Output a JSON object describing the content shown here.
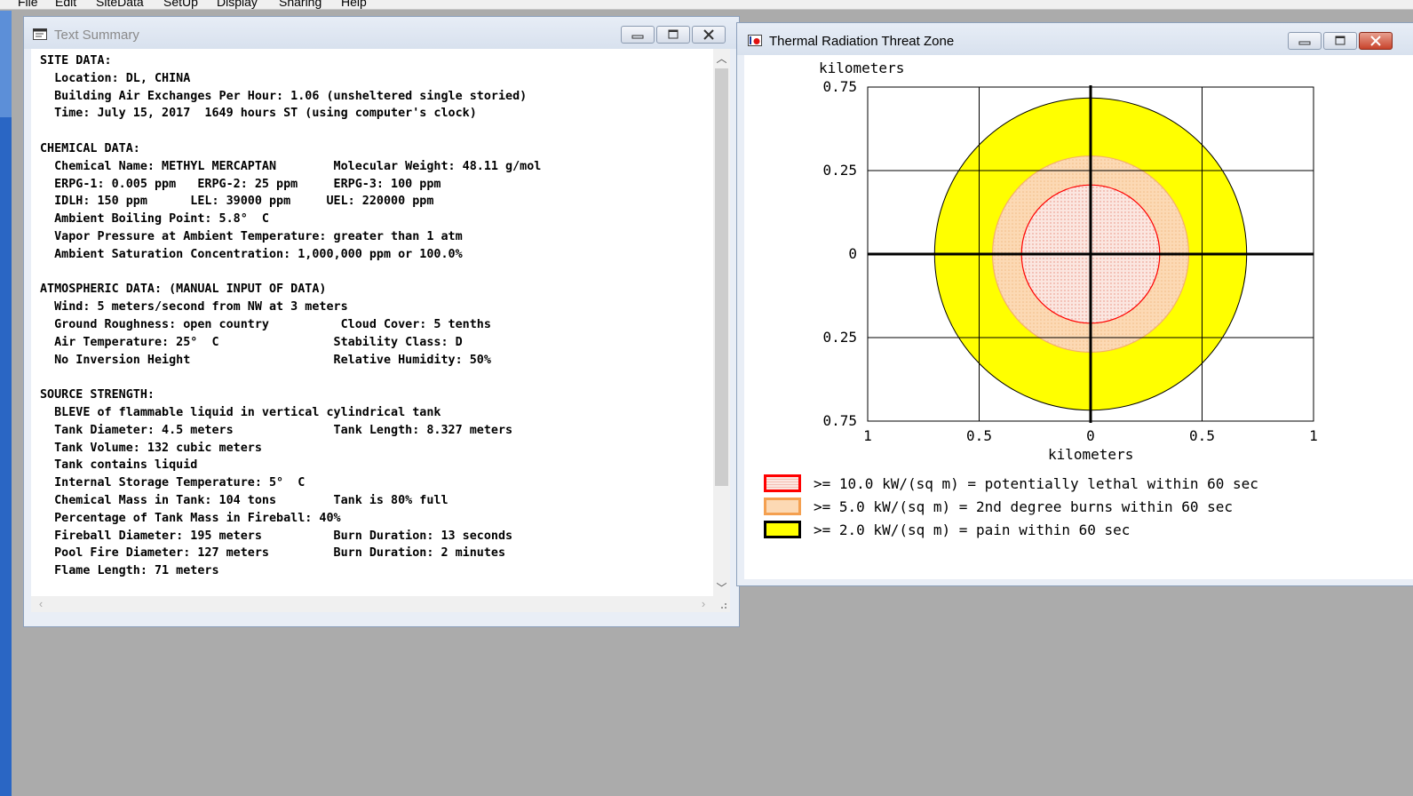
{
  "menu": [
    "File",
    "Edit",
    "SiteData",
    "SetUp",
    "Display",
    "Sharing",
    "Help"
  ],
  "text_window": {
    "title": "Text Summary",
    "lines": [
      "SITE DATA:",
      "  Location: DL, CHINA",
      "  Building Air Exchanges Per Hour: 1.06 (unsheltered single storied)",
      "  Time: July 15, 2017  1649 hours ST (using computer's clock)",
      "",
      "CHEMICAL DATA:",
      "  Chemical Name: METHYL MERCAPTAN        Molecular Weight: 48.11 g/mol",
      "  ERPG-1: 0.005 ppm   ERPG-2: 25 ppm     ERPG-3: 100 ppm",
      "  IDLH: 150 ppm      LEL: 39000 ppm     UEL: 220000 ppm",
      "  Ambient Boiling Point: 5.8°  C",
      "  Vapor Pressure at Ambient Temperature: greater than 1 atm",
      "  Ambient Saturation Concentration: 1,000,000 ppm or 100.0%",
      "",
      "ATMOSPHERIC DATA: (MANUAL INPUT OF DATA)",
      "  Wind: 5 meters/second from NW at 3 meters",
      "  Ground Roughness: open country          Cloud Cover: 5 tenths",
      "  Air Temperature: 25°  C                Stability Class: D",
      "  No Inversion Height                    Relative Humidity: 50%",
      "",
      "SOURCE STRENGTH:",
      "  BLEVE of flammable liquid in vertical cylindrical tank",
      "  Tank Diameter: 4.5 meters              Tank Length: 8.327 meters",
      "  Tank Volume: 132 cubic meters",
      "  Tank contains liquid",
      "  Internal Storage Temperature: 5°  C",
      "  Chemical Mass in Tank: 104 tons        Tank is 80% full",
      "  Percentage of Tank Mass in Fireball: 40%",
      "  Fireball Diameter: 195 meters          Burn Duration: 13 seconds",
      "  Pool Fire Diameter: 127 meters         Burn Duration: 2 minutes",
      "  Flame Length: 71 meters"
    ]
  },
  "plot_window": {
    "title": "Thermal Radiation Threat Zone",
    "y_unit": "kilometers",
    "x_unit": "kilometers",
    "y_ticks": [
      "0.75",
      "0.25",
      "0",
      "0.25",
      "0.75"
    ],
    "x_ticks": [
      "1",
      "0.5",
      "0",
      "0.5",
      "1"
    ],
    "colors": {
      "lethal_edge": "#ff0000",
      "lethal_fill": "#fbe6e0",
      "burn_edge": "#f4b06a",
      "burn_fill": "#fcd9b4",
      "pain_fill": "#ffff00",
      "pain_edge": "#000000"
    },
    "legend": [
      {
        "text": ">= 10.0 kW/(sq m) = potentially lethal within 60 sec"
      },
      {
        "text": ">= 5.0 kW/(sq m) = 2nd degree burns within 60 sec"
      },
      {
        "text": ">= 2.0 kW/(sq m) = pain within 60 sec"
      }
    ]
  },
  "chart_data": {
    "type": "scatter",
    "xlabel": "kilometers",
    "ylabel": "kilometers",
    "xlim": [
      -1,
      1
    ],
    "ylim": [
      -0.75,
      0.75
    ],
    "grid": true,
    "zones": [
      {
        "name": ">= 10.0 kW/(sq m) = potentially lethal within 60 sec",
        "radius_km": 0.31
      },
      {
        "name": ">= 5.0 kW/(sq m) = 2nd degree burns within 60 sec",
        "radius_km": 0.44
      },
      {
        "name": ">= 2.0 kW/(sq m) = pain within 60 sec",
        "radius_km": 0.7
      }
    ]
  }
}
